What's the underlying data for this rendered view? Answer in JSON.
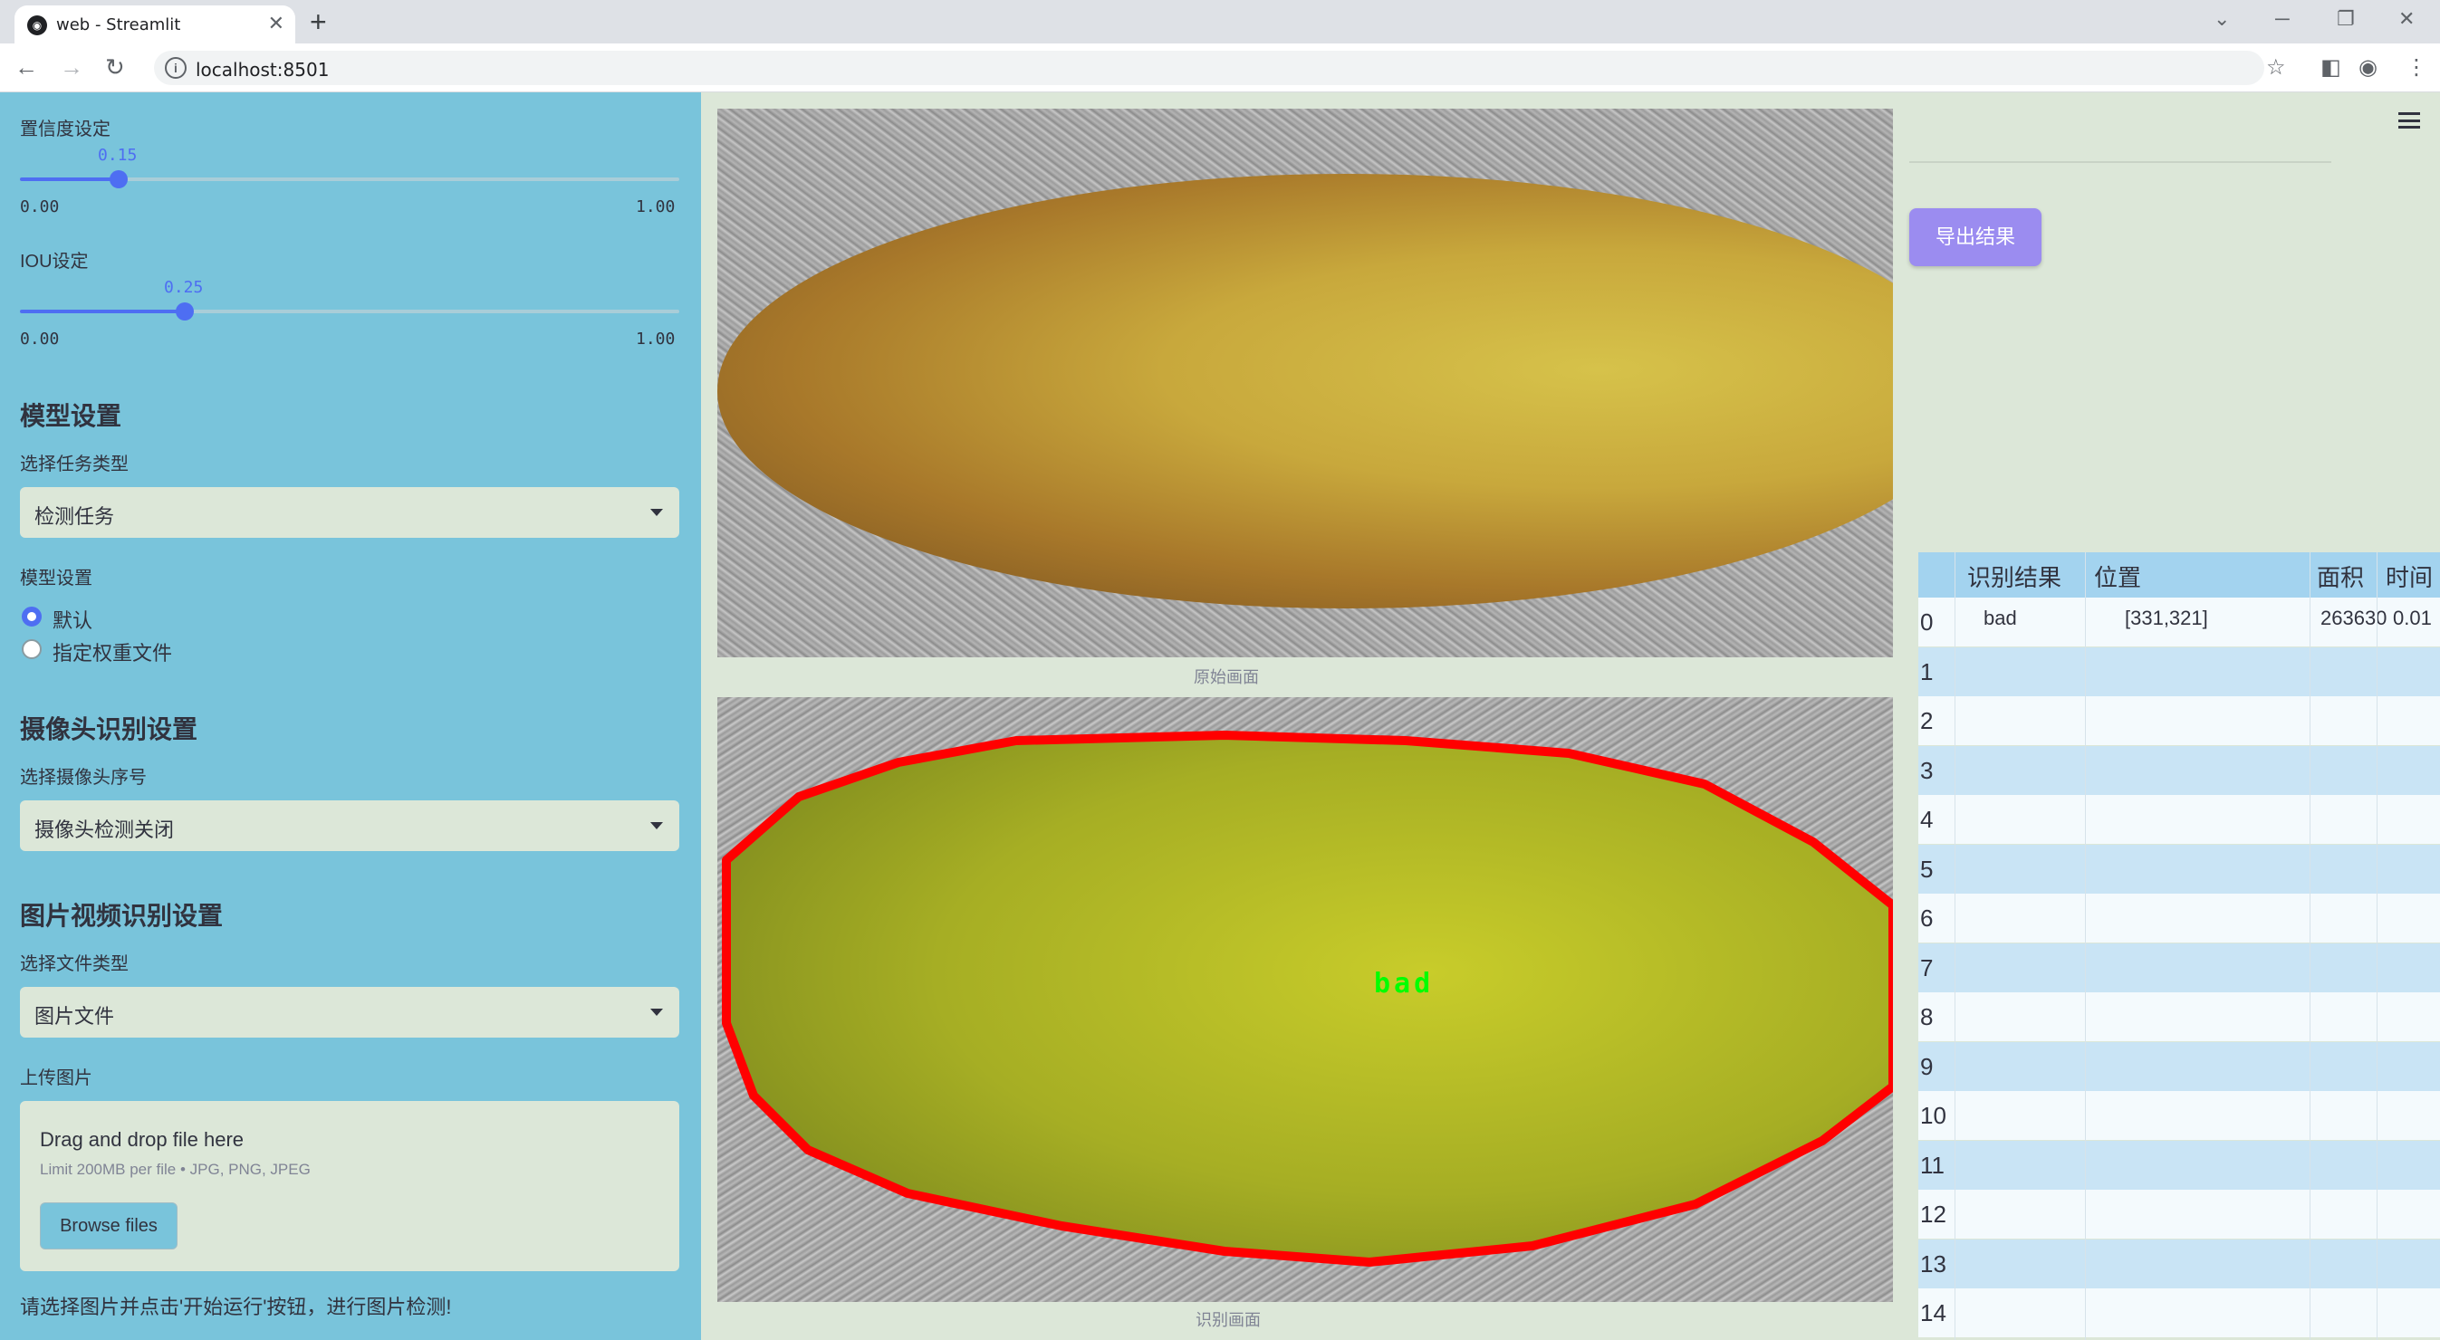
{
  "browser": {
    "tab_title": "web - Streamlit",
    "url": "localhost:8501"
  },
  "sidebar": {
    "confidence": {
      "label": "置信度设定",
      "value": "0.15",
      "min": "0.00",
      "max": "1.00",
      "fraction": 0.15
    },
    "iou": {
      "label": "IOU设定",
      "value": "0.25",
      "min": "0.00",
      "max": "1.00",
      "fraction": 0.25
    },
    "model_section": "模型设置",
    "task_type_label": "选择任务类型",
    "task_type_value": "检测任务",
    "model_setting_label": "模型设置",
    "model_options": [
      "默认",
      "指定权重文件"
    ],
    "model_selected": 0,
    "camera_section": "摄像头识别设置",
    "camera_label": "选择摄像头序号",
    "camera_value": "摄像头检测关闭",
    "media_section": "图片视频识别设置",
    "file_type_label": "选择文件类型",
    "file_type_value": "图片文件",
    "upload_label": "上传图片",
    "upload_title": "Drag and drop file here",
    "upload_limit": "Limit 200MB per file • JPG, PNG, JPEG",
    "browse_label": "Browse files",
    "note": "请选择图片并点击'开始运行'按钮，进行图片检测!"
  },
  "main": {
    "original_caption": "原始画面",
    "detected_caption": "识别画面",
    "detection_label": "bad",
    "detection_color": "#ff0000",
    "label_color": "#00ff00"
  },
  "right": {
    "export_label": "导出结果",
    "table_headers": [
      "识别结果",
      "位置",
      "面积",
      "时间"
    ],
    "row_indices": [
      "0",
      "1",
      "2",
      "3",
      "4",
      "5",
      "6",
      "7",
      "8",
      "9",
      "10",
      "11",
      "12",
      "13",
      "14"
    ],
    "rows": [
      {
        "result": "bad",
        "position": "[331,321]",
        "area": "263630",
        "time": "0.01"
      }
    ]
  }
}
